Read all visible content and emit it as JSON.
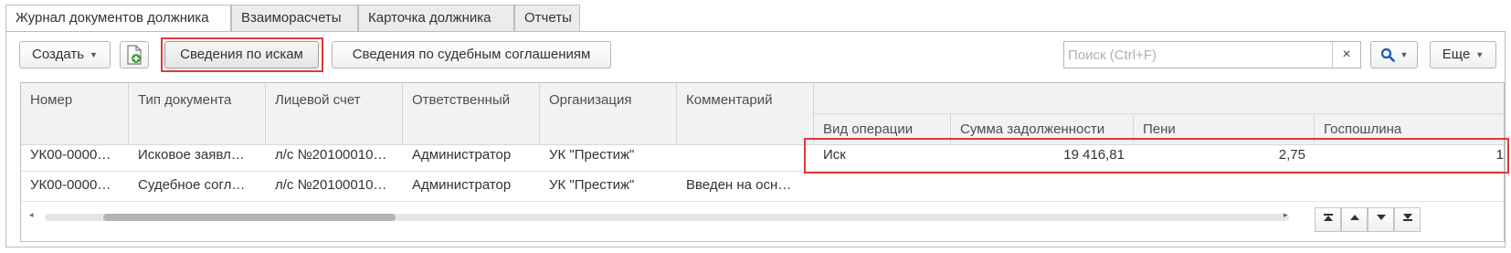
{
  "tabs": [
    {
      "label": "Журнал документов должника",
      "active": true
    },
    {
      "label": "Взаиморасчеты",
      "active": false
    },
    {
      "label": "Карточка должника",
      "active": false
    },
    {
      "label": "Отчеты",
      "active": false
    }
  ],
  "toolbar": {
    "create_label": "Создать",
    "claims_info_label": "Сведения по искам",
    "court_agreements_label": "Сведения по судебным соглашениям",
    "search_placeholder": "Поиск (Ctrl+F)",
    "search_value": "",
    "clear_glyph": "×",
    "more_label": "Еще"
  },
  "grid": {
    "columns": [
      "Номер",
      "Тип документа",
      "Лицевой счет",
      "Ответственный",
      "Организация",
      "Комментарий"
    ],
    "sub_columns": [
      "Вид операции",
      "Сумма задолженности",
      "Пени",
      "Госпошлина"
    ],
    "rows": [
      {
        "number": "УК00-0000…",
        "doc_type": "Исковое заявл…",
        "account": "л/с №20100010…",
        "responsible": "Администратор",
        "organization": "УК \"Престиж\"",
        "comment": "",
        "operation": "Иск",
        "debt": "19 416,81",
        "penalty": "2,75",
        "duty": "1"
      },
      {
        "number": "УК00-0000…",
        "doc_type": "Судебное согл…",
        "account": "л/с №20100010…",
        "responsible": "Администратор",
        "organization": "УК \"Престиж\"",
        "comment": "Введен на осн…",
        "operation": "",
        "debt": "",
        "penalty": "",
        "duty": ""
      }
    ]
  },
  "icons": {
    "add_document": "add-document-icon",
    "search": "magnifier-icon",
    "dropdown": "chevron-down-icon"
  },
  "colors": {
    "highlight": "#e0383a",
    "search_icon": "#1a57b4",
    "add_icon": "#3aa33a"
  }
}
